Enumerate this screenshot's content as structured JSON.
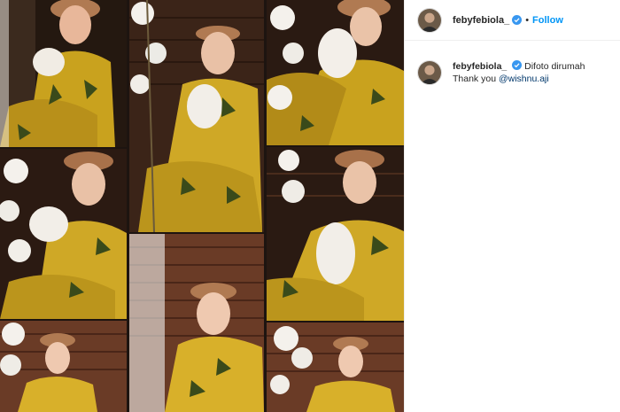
{
  "post": {
    "username": "febyfebiola_",
    "follow_label": "Follow",
    "separator": "•"
  },
  "caption": {
    "username": "febyfebiola_",
    "text": "Difoto dirumah",
    "line2_prefix": "Thank you",
    "mention": "@wishnu.aji"
  },
  "colors": {
    "accent": "#0095f6",
    "verified": "#3897f0",
    "dress": "#c9a21e",
    "wood": "#5a3220"
  },
  "icons": {
    "verified": "verified-badge-icon"
  }
}
